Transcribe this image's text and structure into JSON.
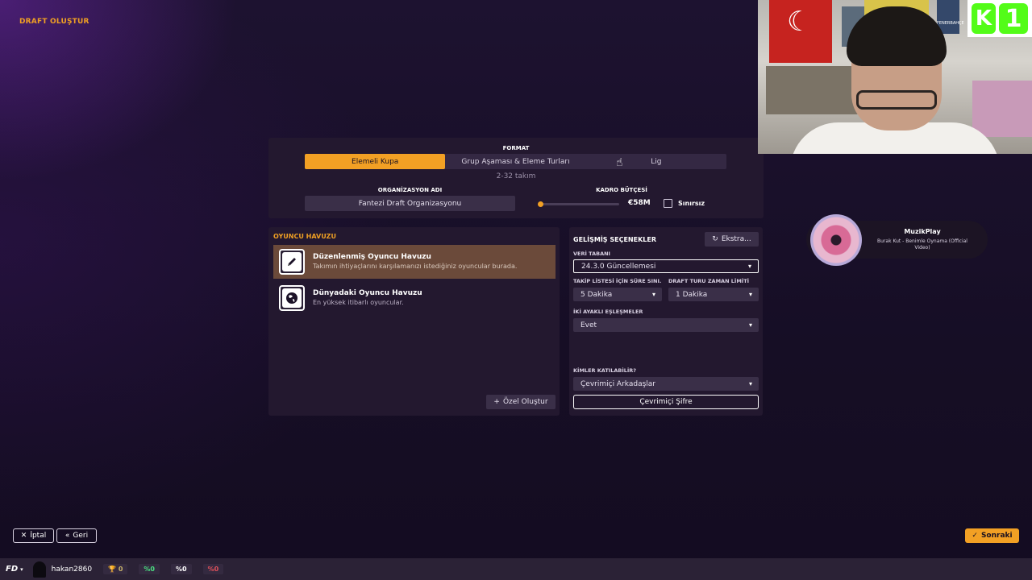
{
  "screen": {
    "title": "DRAFT OLUŞTUR"
  },
  "format": {
    "label": "FORMAT",
    "options": [
      "Elemeli Kupa",
      "Grup Aşaması & Eleme Turları",
      "Lig"
    ],
    "selected": "Elemeli Kupa",
    "team_range": "2-32 takım"
  },
  "organization": {
    "label": "ORGANİZASYON ADI",
    "value": "Fantezi Draft Organizasyonu"
  },
  "budget": {
    "label": "KADRO BÜTÇESİ",
    "value": "€58M",
    "slider_fraction": 0.0,
    "unlimited_label": "Sınırsız",
    "unlimited_checked": false
  },
  "player_pool": {
    "title": "OYUNCU HAVUZU",
    "items": [
      {
        "name": "Düzenlenmiş Oyuncu Havuzu",
        "desc": "Takımın ihtiyaçlarını karşılamanızı istediğiniz oyuncular burada.",
        "icon": "pencil-icon",
        "selected": true
      },
      {
        "name": "Dünyadaki Oyuncu Havuzu",
        "desc": "En yüksek itibarlı oyuncular.",
        "icon": "globe-icon",
        "selected": false
      }
    ],
    "custom_button": "Özel Oluştur"
  },
  "advanced": {
    "title": "GELİŞMİŞ SEÇENEKLER",
    "extra_button": "Ekstra...",
    "database": {
      "label": "VERİ TABANI",
      "value": "24.3.0 Güncellemesi"
    },
    "watchlist": {
      "label": "TAKİP LİSTESİ İÇİN SÜRE SINI...",
      "value": "5 Dakika"
    },
    "draft_time": {
      "label": "DRAFT TURU ZAMAN LİMİTİ",
      "value": "1 Dakika"
    },
    "two_legged": {
      "label": "İKİ AYAKLI EŞLEŞMELER",
      "value": "Evet"
    },
    "who_can_join": {
      "label": "KİMLER KATILABİLİR?",
      "value": "Çevrimiçi Arkadaşlar"
    },
    "password_button": "Çevrimiçi Şifre"
  },
  "footer": {
    "cancel": "İptal",
    "back": "Geri",
    "next": "Sonraki"
  },
  "status_bar": {
    "logo": "FD",
    "username": "hakan2860",
    "trophies": "0",
    "win_pct": "%0",
    "draw_pct": "%0",
    "loss_pct": "%0"
  },
  "music_widget": {
    "title": "MuzikPlay",
    "song": "Burak Kut - Benimle Oynama (Official Video)"
  },
  "webcam": {
    "badge": [
      "K",
      "1"
    ],
    "poster_text": "FENERBAHÇE"
  },
  "colors": {
    "accent": "#f2a024",
    "panel": "#23182f",
    "win": "#4ade80",
    "loss": "#e0505a"
  }
}
